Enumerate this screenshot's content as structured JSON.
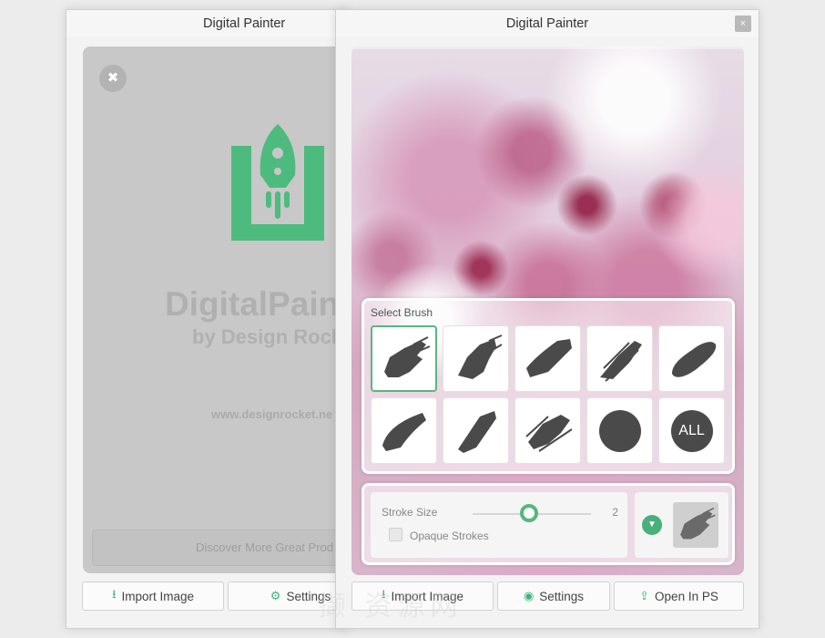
{
  "back_window": {
    "title": "Digital Painter",
    "brand_name": "DigitalPain",
    "brand_by": "by Design Rock",
    "brand_url": "www.designrocket.ne",
    "discover_label": "Discover More Great Prod",
    "buttons": {
      "import": "Import Image",
      "settings": "Settings"
    }
  },
  "front_window": {
    "title": "Digital Painter",
    "close_label": "×",
    "brush_panel": {
      "label": "Select Brush",
      "selected_index": 0,
      "all_label": "ALL"
    },
    "stroke": {
      "label": "Stroke Size",
      "value": "2",
      "slider_fraction": 0.48,
      "opaque_label": "Opaque Strokes",
      "opaque_checked": false
    },
    "buttons": {
      "import": "Import Image",
      "settings": "Settings",
      "open_ps": "Open In PS"
    }
  },
  "colors": {
    "accent": "#48b07a",
    "brush": "#4a4a4a"
  },
  "icons": [
    "tools-icon",
    "rocket-logo-icon",
    "import-icon",
    "gear-icon",
    "eye-icon",
    "open-in-icon",
    "chevron-down-icon",
    "close-icon"
  ],
  "watermark": "撷 资源网"
}
